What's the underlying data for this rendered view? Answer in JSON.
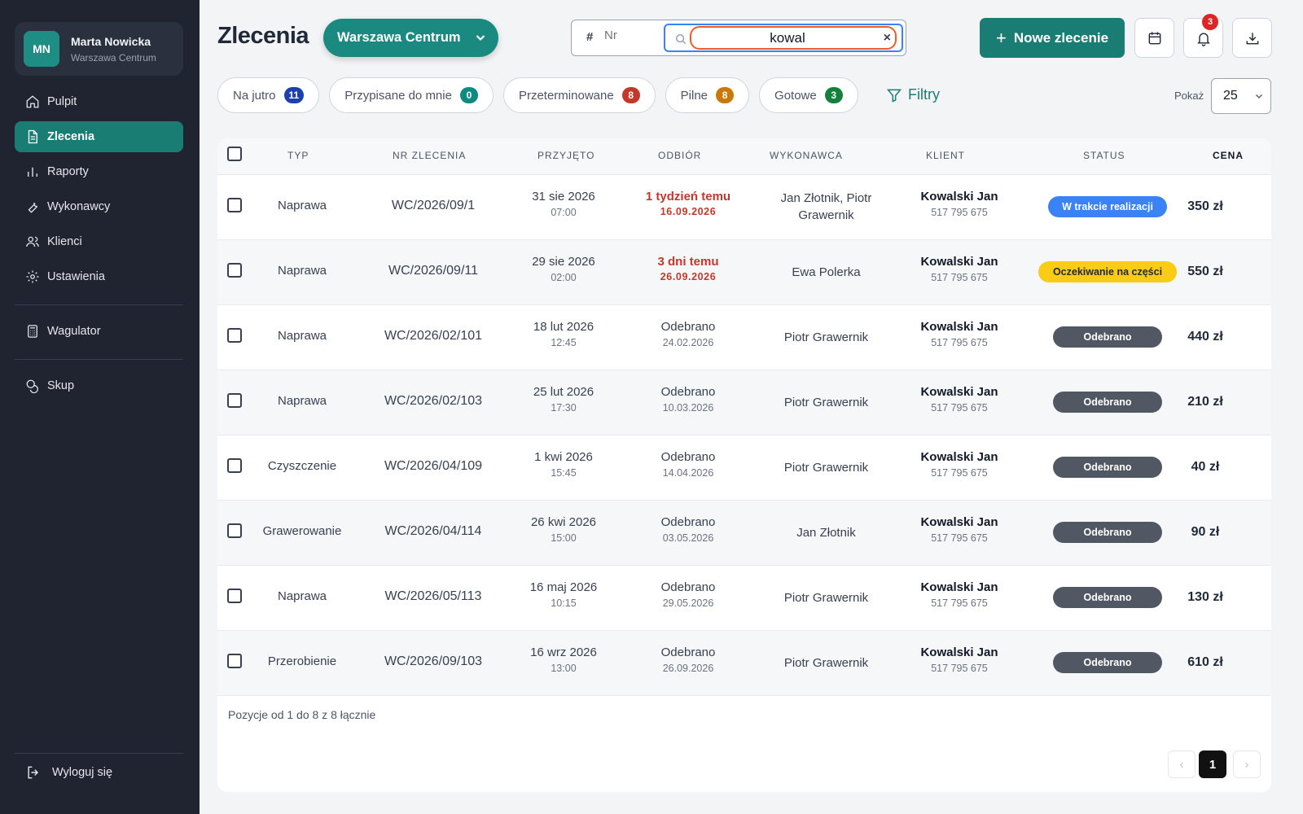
{
  "user": {
    "initials": "MN",
    "name": "Marta Nowicka",
    "branch": "Warszawa Centrum"
  },
  "nav": {
    "items": [
      "Pulpit",
      "Zlecenia",
      "Raporty",
      "Wykonawcy",
      "Klienci",
      "Ustawienia"
    ],
    "wagulator": "Wagulator",
    "skup": "Skup",
    "logout": "Wyloguj się"
  },
  "header": {
    "title": "Zlecenia",
    "branch": "Warszawa Centrum",
    "search_nr_symbol": "#",
    "search_nr_placeholder": "Nr",
    "search_client_value": "kowal",
    "clear_symbol": "×",
    "new_order": "Nowe zlecenie",
    "notifications_count": "3"
  },
  "chips": [
    {
      "label": "Na jutro",
      "count": "11",
      "color": "#1e40af"
    },
    {
      "label": "Przypisane do mnie",
      "count": "0",
      "color": "#0f8a80"
    },
    {
      "label": "Przeterminowane",
      "count": "8",
      "color": "#c0392b"
    },
    {
      "label": "Pilne",
      "count": "8",
      "color": "#c77a0a"
    },
    {
      "label": "Gotowe",
      "count": "3",
      "color": "#15803d"
    }
  ],
  "filters_label": "Filtry",
  "show_label": "Pokaż",
  "page_size": "25",
  "table": {
    "headers": [
      "Typ",
      "Nr zlecenia",
      "Przyjęto",
      "Odbiór",
      "Wykonawca",
      "Klient",
      "Status",
      "Cena"
    ],
    "rows": [
      {
        "typ": "Naprawa",
        "nr": "WC/2026/09/1",
        "przyjeto_date": "31 sie 2026",
        "przyjeto_time": "07:00",
        "odbior_main": "1 tydzień temu",
        "odbior_sub": "16.09.2026",
        "overdue": true,
        "wykonawca": "Jan Złotnik, Piotr Grawernik",
        "klient": "Kowalski Jan",
        "telefon": "517 795 675",
        "status": "W trakcie realizacji",
        "status_bg": "#3b82f6",
        "status_fg": "#ffffff",
        "cena": "350 zł"
      },
      {
        "typ": "Naprawa",
        "nr": "WC/2026/09/11",
        "przyjeto_date": "29 sie 2026",
        "przyjeto_time": "02:00",
        "odbior_main": "3 dni temu",
        "odbior_sub": "26.09.2026",
        "overdue": true,
        "wykonawca": "Ewa Polerka",
        "klient": "Kowalski Jan",
        "telefon": "517 795 675",
        "status": "Oczekiwanie na części",
        "status_bg": "#facc15",
        "status_fg": "#1f2937",
        "cena": "550 zł"
      },
      {
        "typ": "Naprawa",
        "nr": "WC/2026/02/101",
        "przyjeto_date": "18 lut 2026",
        "przyjeto_time": "12:45",
        "odbior_main": "Odebrano",
        "odbior_sub": "24.02.2026",
        "overdue": false,
        "wykonawca": "Piotr Grawernik",
        "klient": "Kowalski Jan",
        "telefon": "517 795 675",
        "status": "Odebrano",
        "status_bg": "#525863",
        "status_fg": "#ffffff",
        "cena": "440 zł"
      },
      {
        "typ": "Naprawa",
        "nr": "WC/2026/02/103",
        "przyjeto_date": "25 lut 2026",
        "przyjeto_time": "17:30",
        "odbior_main": "Odebrano",
        "odbior_sub": "10.03.2026",
        "overdue": false,
        "wykonawca": "Piotr Grawernik",
        "klient": "Kowalski Jan",
        "telefon": "517 795 675",
        "status": "Odebrano",
        "status_bg": "#525863",
        "status_fg": "#ffffff",
        "cena": "210 zł"
      },
      {
        "typ": "Czyszczenie",
        "nr": "WC/2026/04/109",
        "przyjeto_date": "1 kwi 2026",
        "przyjeto_time": "15:45",
        "odbior_main": "Odebrano",
        "odbior_sub": "14.04.2026",
        "overdue": false,
        "wykonawca": "Piotr Grawernik",
        "klient": "Kowalski Jan",
        "telefon": "517 795 675",
        "status": "Odebrano",
        "status_bg": "#525863",
        "status_fg": "#ffffff",
        "cena": "40 zł"
      },
      {
        "typ": "Grawerowanie",
        "nr": "WC/2026/04/114",
        "przyjeto_date": "26 kwi 2026",
        "przyjeto_time": "15:00",
        "odbior_main": "Odebrano",
        "odbior_sub": "03.05.2026",
        "overdue": false,
        "wykonawca": "Jan Złotnik",
        "klient": "Kowalski Jan",
        "telefon": "517 795 675",
        "status": "Odebrano",
        "status_bg": "#525863",
        "status_fg": "#ffffff",
        "cena": "90 zł"
      },
      {
        "typ": "Naprawa",
        "nr": "WC/2026/05/113",
        "przyjeto_date": "16 maj 2026",
        "przyjeto_time": "10:15",
        "odbior_main": "Odebrano",
        "odbior_sub": "29.05.2026",
        "overdue": false,
        "wykonawca": "Piotr Grawernik",
        "klient": "Kowalski Jan",
        "telefon": "517 795 675",
        "status": "Odebrano",
        "status_bg": "#525863",
        "status_fg": "#ffffff",
        "cena": "130 zł"
      },
      {
        "typ": "Przerobienie",
        "nr": "WC/2026/09/103",
        "przyjeto_date": "16 wrz 2026",
        "przyjeto_time": "13:00",
        "odbior_main": "Odebrano",
        "odbior_sub": "26.09.2026",
        "overdue": false,
        "wykonawca": "Piotr Grawernik",
        "klient": "Kowalski Jan",
        "telefon": "517 795 675",
        "status": "Odebrano",
        "status_bg": "#525863",
        "status_fg": "#ffffff",
        "cena": "610 zł"
      }
    ],
    "footer": "Pozycje od 1 do 8 z 8 łącznie"
  },
  "pagination": {
    "prev": "‹",
    "current": "1",
    "next": "›"
  }
}
